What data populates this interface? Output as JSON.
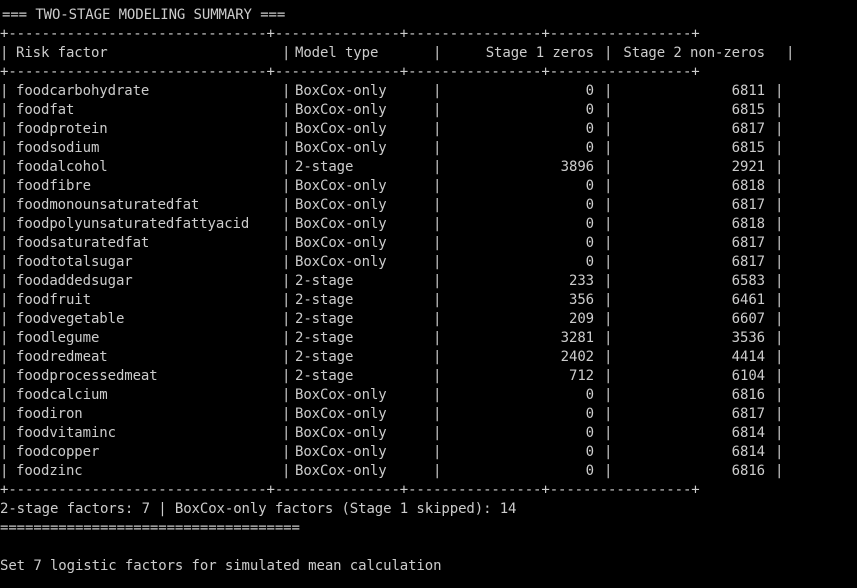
{
  "title": "=== TWO-STAGE MODELING SUMMARY ===",
  "border": "+-------------------------------+---------------+----------------+-----------------+",
  "header": {
    "risk_factor": "Risk factor",
    "model_type": "Model type",
    "stage1": "Stage 1 zeros",
    "stage2": "Stage 2 non-zeros"
  },
  "rows": [
    {
      "name": "foodcarbohydrate",
      "type": "BoxCox-only",
      "z1": "0",
      "z2": "6811"
    },
    {
      "name": "foodfat",
      "type": "BoxCox-only",
      "z1": "0",
      "z2": "6815"
    },
    {
      "name": "foodprotein",
      "type": "BoxCox-only",
      "z1": "0",
      "z2": "6817"
    },
    {
      "name": "foodsodium",
      "type": "BoxCox-only",
      "z1": "0",
      "z2": "6815"
    },
    {
      "name": "foodalcohol",
      "type": "2-stage",
      "z1": "3896",
      "z2": "2921"
    },
    {
      "name": "foodfibre",
      "type": "BoxCox-only",
      "z1": "0",
      "z2": "6818"
    },
    {
      "name": "foodmonounsaturatedfat",
      "type": "BoxCox-only",
      "z1": "0",
      "z2": "6817"
    },
    {
      "name": "foodpolyunsaturatedfattyacid",
      "type": "BoxCox-only",
      "z1": "0",
      "z2": "6818"
    },
    {
      "name": "foodsaturatedfat",
      "type": "BoxCox-only",
      "z1": "0",
      "z2": "6817"
    },
    {
      "name": "foodtotalsugar",
      "type": "BoxCox-only",
      "z1": "0",
      "z2": "6817"
    },
    {
      "name": "foodaddedsugar",
      "type": "2-stage",
      "z1": "233",
      "z2": "6583"
    },
    {
      "name": "foodfruit",
      "type": "2-stage",
      "z1": "356",
      "z2": "6461"
    },
    {
      "name": "foodvegetable",
      "type": "2-stage",
      "z1": "209",
      "z2": "6607"
    },
    {
      "name": "foodlegume",
      "type": "2-stage",
      "z1": "3281",
      "z2": "3536"
    },
    {
      "name": "foodredmeat",
      "type": "2-stage",
      "z1": "2402",
      "z2": "4414"
    },
    {
      "name": "foodprocessedmeat",
      "type": "2-stage",
      "z1": "712",
      "z2": "6104"
    },
    {
      "name": "foodcalcium",
      "type": "BoxCox-only",
      "z1": "0",
      "z2": "6816"
    },
    {
      "name": "foodiron",
      "type": "BoxCox-only",
      "z1": "0",
      "z2": "6817"
    },
    {
      "name": "foodvitaminc",
      "type": "BoxCox-only",
      "z1": "0",
      "z2": "6814"
    },
    {
      "name": "foodcopper",
      "type": "BoxCox-only",
      "z1": "0",
      "z2": "6814"
    },
    {
      "name": "foodzinc",
      "type": "BoxCox-only",
      "z1": "0",
      "z2": "6816"
    }
  ],
  "summary": "2-stage factors: 7 | BoxCox-only factors (Stage 1 skipped): 14",
  "rule": "====================================",
  "final": "Set 7 logistic factors for simulated mean calculation"
}
